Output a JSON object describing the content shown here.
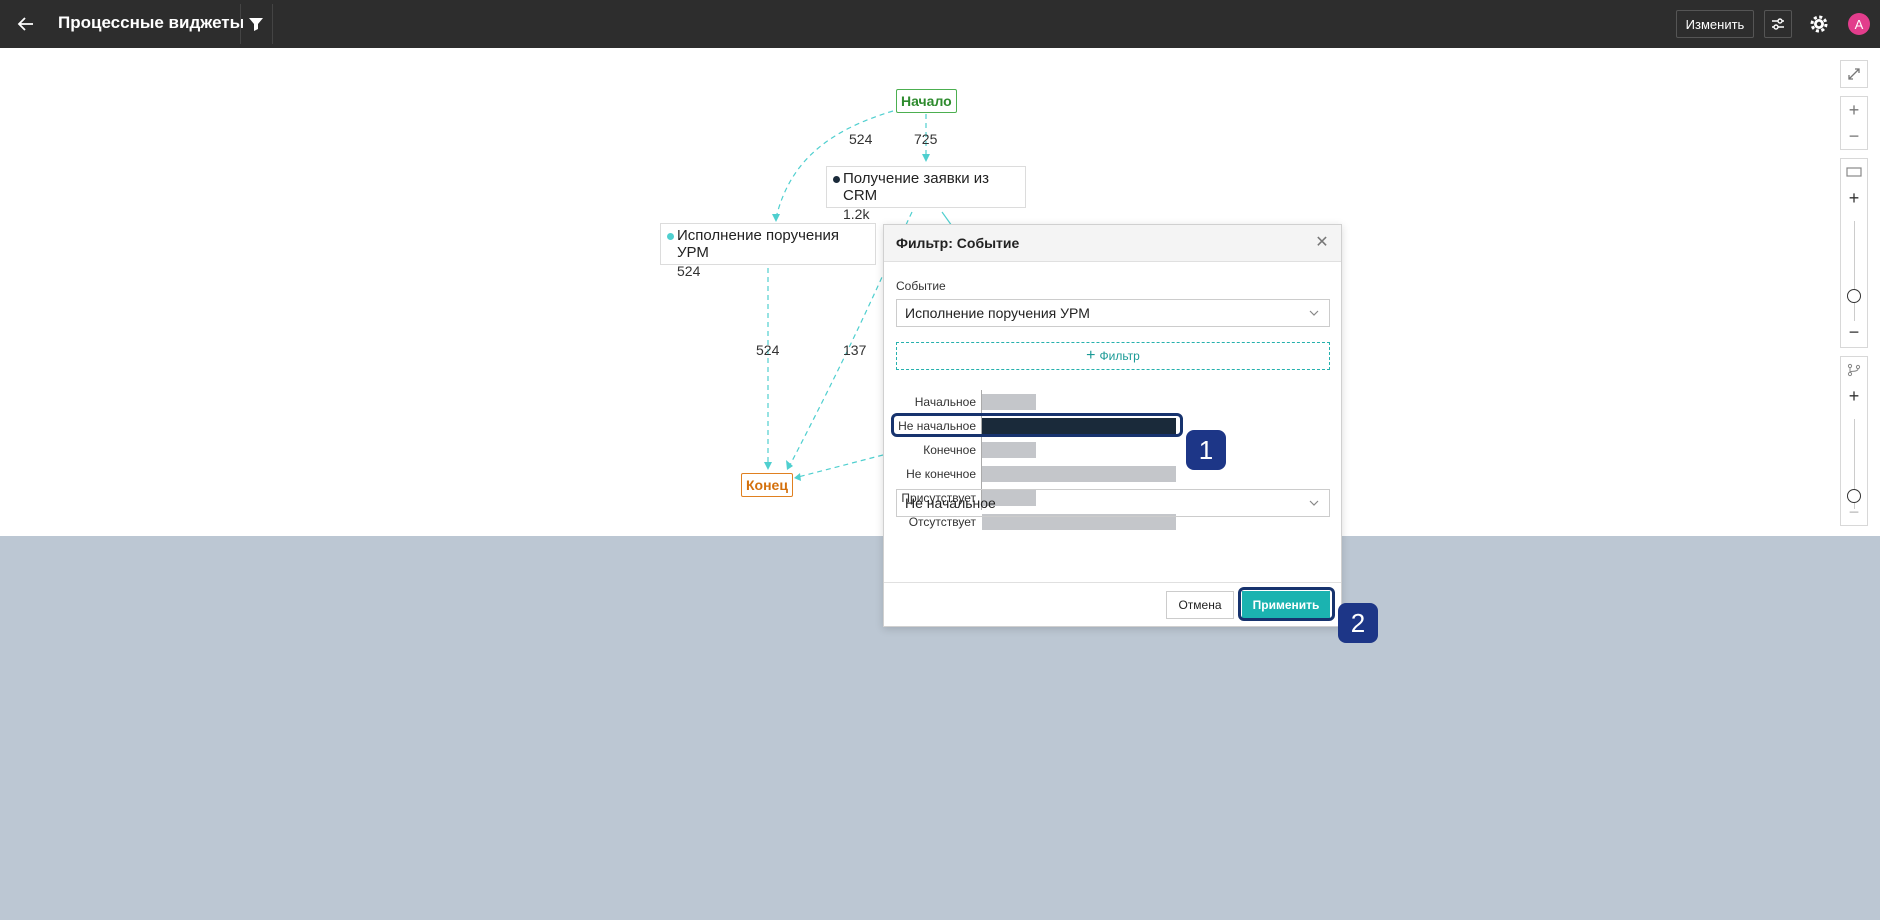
{
  "header": {
    "title": "Процессные виджеты",
    "edit_label": "Изменить",
    "avatar_letter": "A"
  },
  "graph": {
    "start_label": "Начало",
    "end_label": "Конец",
    "nodes": [
      {
        "label": "Получение заявки из CRM",
        "count": "1.2k"
      },
      {
        "label": "Исполнение поручения УРМ",
        "count": "524"
      }
    ],
    "edge_labels": [
      "524",
      "725",
      "524",
      "137"
    ]
  },
  "dialog": {
    "title": "Фильтр: Событие",
    "event_label": "Событие",
    "event_value": "Исполнение поручения УРМ",
    "add_filter_label": "Фильтр",
    "bars": [
      {
        "label": "Начальное",
        "value": 0.28
      },
      {
        "label": "Не начальное",
        "value": 1.0
      },
      {
        "label": "Конечное",
        "value": 0.28
      },
      {
        "label": "Не конечное",
        "value": 1.0
      },
      {
        "label": "Присутствует",
        "value": 0.28
      },
      {
        "label": "Отсутствует",
        "value": 1.0
      }
    ],
    "selected_value": "Не начальное",
    "cancel_label": "Отмена",
    "apply_label": "Применить"
  },
  "annotations": {
    "badge_1": "1",
    "badge_2": "2"
  },
  "colors": {
    "accent": "#1bb3b0",
    "highlight": "#17336e",
    "start": "#2e8b2e",
    "end": "#d4700c"
  }
}
